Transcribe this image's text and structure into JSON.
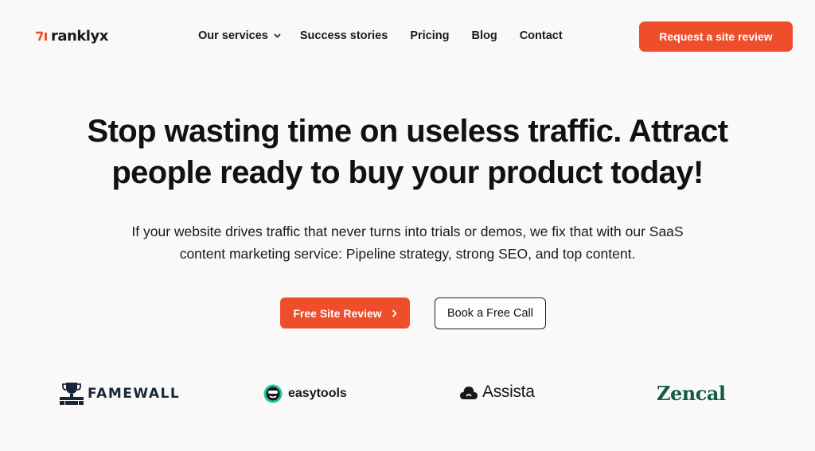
{
  "brand": {
    "name": "ranklyx",
    "accent": "#ee4e2c"
  },
  "nav": {
    "items": [
      {
        "label": "Our services",
        "has_dropdown": true
      },
      {
        "label": "Success stories"
      },
      {
        "label": "Pricing"
      },
      {
        "label": "Blog"
      },
      {
        "label": "Contact"
      }
    ],
    "cta_label": "Request a site review"
  },
  "hero": {
    "title_lines": [
      "Stop wasting time on useless traffic. Attract",
      "people ready to buy your product today!"
    ],
    "subtitle_lines": [
      "If your website drives traffic that never turns into trials or demos, we fix that with our SaaS",
      "content marketing service: Pipeline strategy, strong SEO, and top content."
    ],
    "primary_button": "Free Site Review",
    "secondary_button": "Book a Free Call"
  },
  "clients": [
    {
      "name": "FAMEWALL",
      "icon": "famewall-trophy-icon"
    },
    {
      "name": "easytools",
      "icon": "easytools-face-icon"
    },
    {
      "name": "Assista",
      "icon": "assista-cloud-icon"
    },
    {
      "name": "Zencal",
      "icon": "none"
    }
  ],
  "colors": {
    "background": "#faf9f7",
    "accent": "#ee4e2c",
    "text": "#111111",
    "zencal_green": "#145a45",
    "famewall_navy": "#18263a"
  }
}
